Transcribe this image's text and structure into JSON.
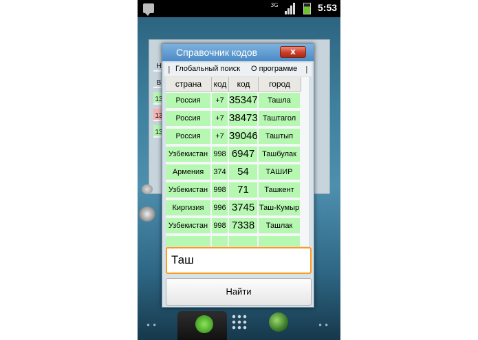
{
  "statusbar": {
    "network": "3G",
    "time": "5:53"
  },
  "dialog": {
    "title": "Справочник кодов",
    "close_label": "x",
    "menu": [
      "Глобальный поиск",
      "О программе"
    ],
    "menu_separator": "|"
  },
  "table": {
    "headers": [
      "страна",
      "код",
      "код",
      "город"
    ],
    "rows": [
      {
        "country": "Россия",
        "prefix": "+7",
        "code": "35347",
        "city": "Ташла"
      },
      {
        "country": "Россия",
        "prefix": "+7",
        "code": "38473",
        "city": "Таштагол"
      },
      {
        "country": "Россия",
        "prefix": "+7",
        "code": "39046",
        "city": "Таштып"
      },
      {
        "country": "Узбекистан",
        "prefix": "998",
        "code": "6947",
        "city": "Ташбулак"
      },
      {
        "country": "Армения",
        "prefix": "374",
        "code": "54",
        "city": "ТАШИР"
      },
      {
        "country": "Узбекистан",
        "prefix": "998",
        "code": "71",
        "city": "Ташкент"
      },
      {
        "country": "Киргизия",
        "prefix": "996",
        "code": "3745",
        "city": "Таш-Кумыр"
      },
      {
        "country": "Узбекистан",
        "prefix": "998",
        "code": "7338",
        "city": "Ташлак"
      },
      {
        "country": "",
        "prefix": "",
        "code": "",
        "city": ""
      }
    ]
  },
  "search": {
    "value": "Таш"
  },
  "find_button": {
    "label": "Найти"
  },
  "background": {
    "cells": [
      "Н",
      "В",
      "13",
      "13",
      "13"
    ]
  },
  "colors": {
    "cell_green": "#b6f7b1",
    "header_gray": "#e9e8e2",
    "title_blue": "#4b8bc6",
    "input_focus": "#ff9a1a",
    "close_red": "#c8402b"
  },
  "icons": [
    "notification-icon",
    "signal-icon",
    "battery-icon",
    "close-icon",
    "phone-icon",
    "apps-grid-icon",
    "browser-globe-icon"
  ]
}
